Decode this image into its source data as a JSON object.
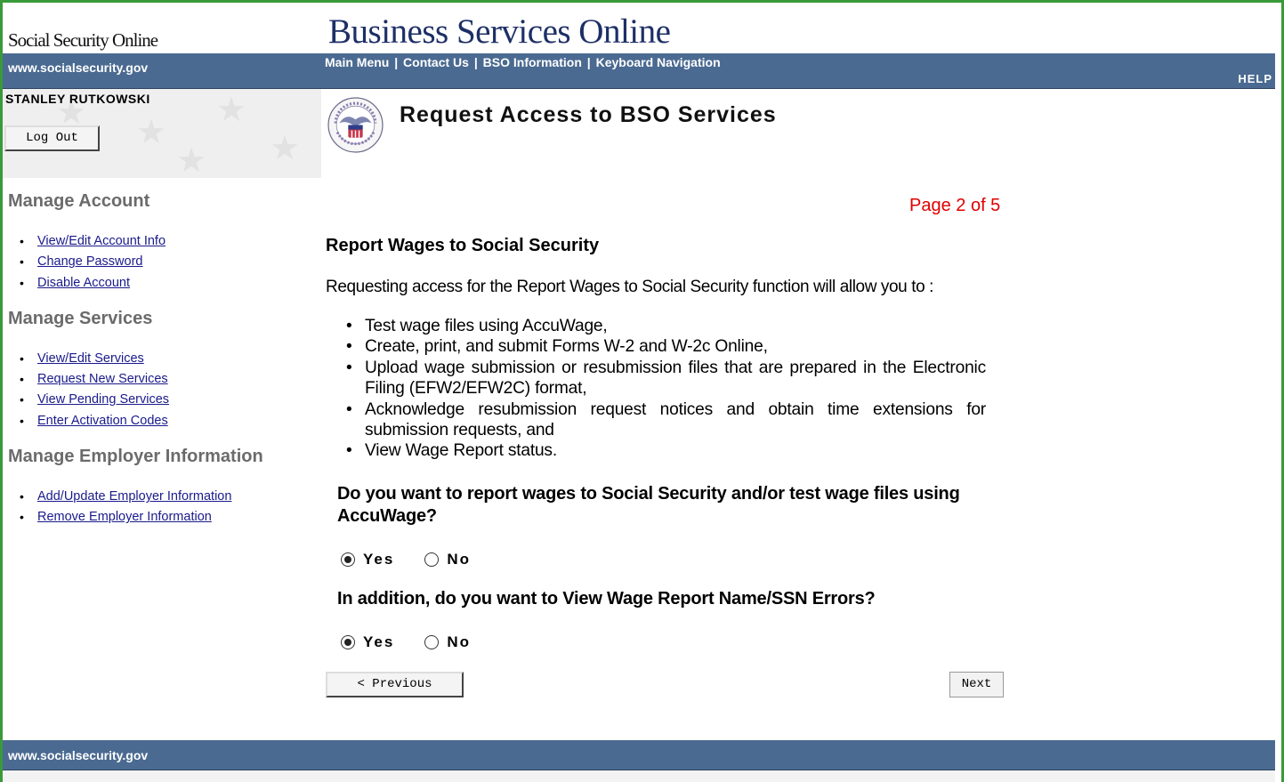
{
  "header": {
    "brand": "Social Security Online",
    "app_title": "Business Services Online",
    "site_url": "www.socialsecurity.gov",
    "nav": [
      "Main Menu",
      "Contact Us",
      "BSO Information",
      "Keyboard Navigation"
    ],
    "nav_separator": "|",
    "help": "HELP"
  },
  "user": {
    "name": "STANLEY RUTKOWSKI",
    "logout_label": "Log Out"
  },
  "sidebar": {
    "sections": [
      {
        "heading": "Manage Account",
        "links": [
          "View/Edit Account Info",
          "Change Password",
          "Disable Account"
        ]
      },
      {
        "heading": "Manage Services",
        "links": [
          "View/Edit Services",
          "Request New Services",
          "View Pending Services",
          "Enter Activation Codes"
        ]
      },
      {
        "heading": "Manage Employer Information",
        "links": [
          "Add/Update Employer Information",
          "Remove Employer Information"
        ]
      }
    ]
  },
  "page": {
    "heading": "Request Access to BSO Services",
    "seal_icon": "ssa-seal-icon",
    "page_indicator": "Page 2 of 5",
    "section_title": "Report Wages to Social Security",
    "intro": "Requesting access for the Report Wages to Social Security function will allow you to :",
    "functions": [
      "Test wage files using AccuWage,",
      "Create, print, and submit Forms W-2 and W-2c Online,",
      "Upload wage submission or resubmission files that are prepared in the Electronic Filing (EFW2/EFW2C) format,",
      "Acknowledge resubmission request notices and obtain time extensions for submission requests, and",
      "View Wage Report status."
    ]
  },
  "questions": [
    {
      "text": "Do you want to report wages to Social Security and/or test wage files using AccuWage?",
      "options": [
        "Yes",
        "No"
      ],
      "selected": "Yes"
    },
    {
      "text": "In addition, do you want to View Wage Report Name/SSN Errors?",
      "options": [
        "Yes",
        "No"
      ],
      "selected": "Yes"
    }
  ],
  "buttons": {
    "previous": "< Previous",
    "next": "Next"
  },
  "footer": {
    "site_url": "www.socialsecurity.gov"
  },
  "colors": {
    "header_bar": "#4a6a91",
    "title_blue": "#1d2f66",
    "page_indicator": "#e00000",
    "link": "#1a1a8c",
    "frame_border": "#3a9a3a"
  }
}
